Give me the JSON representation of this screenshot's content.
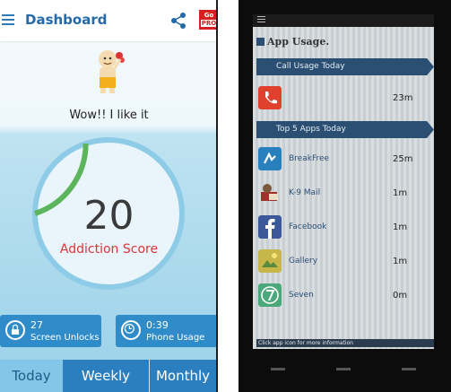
{
  "left": {
    "header": {
      "title": "Dashboard",
      "go_line1": "Go",
      "go_line2": "PRO"
    },
    "message": "Wow!! I like it",
    "score": {
      "value": "20",
      "label": "Addiction Score",
      "fraction": 0.2
    },
    "stats": [
      {
        "value": "27",
        "label": "Screen Unlocks",
        "icon": "lock-icon"
      },
      {
        "value": "0:39",
        "label": "Phone Usage",
        "icon": "clock-icon"
      }
    ],
    "tabs": [
      "Today",
      "Weekly",
      "Monthly"
    ],
    "colors": {
      "accent": "#2b7fbe",
      "score_label": "#d9363a",
      "gauge_fill": "#5cb55c"
    }
  },
  "right": {
    "title": "App Usage.",
    "call_section": "Call Usage Today",
    "call_value": "23m",
    "top_section": "Top 5 Apps Today",
    "apps": [
      {
        "name": "BreakFree",
        "value": "25m",
        "icon": "breakfree-icon"
      },
      {
        "name": "K-9 Mail",
        "value": "1m",
        "icon": "k9-mail-icon"
      },
      {
        "name": "Facebook",
        "value": "1m",
        "icon": "facebook-icon"
      },
      {
        "name": "Gallery",
        "value": "1m",
        "icon": "gallery-icon"
      },
      {
        "name": "Seven",
        "value": "0m",
        "icon": "seven-icon"
      }
    ],
    "hint": "Click app icon for more information"
  }
}
